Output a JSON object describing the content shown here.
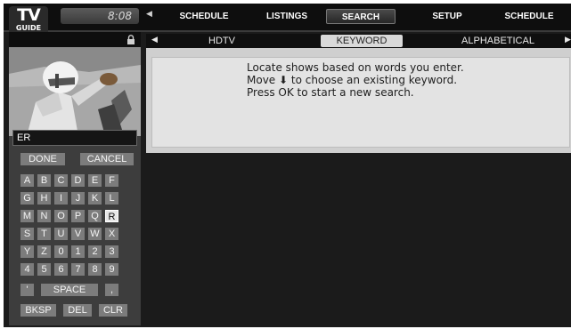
{
  "logo": {
    "line1": "TV",
    "line2": "GUIDE"
  },
  "clock": "8:08",
  "nav": {
    "tabs": [
      {
        "label": "SCHEDULE"
      },
      {
        "label": "LISTINGS"
      },
      {
        "label": "SEARCH"
      },
      {
        "label": "SETUP"
      },
      {
        "label": "SCHEDULE"
      }
    ]
  },
  "subtabs": [
    {
      "label": "HDTV"
    },
    {
      "label": "KEYWORD"
    },
    {
      "label": "ALPHABETICAL"
    }
  ],
  "entry": {
    "value": "ER"
  },
  "keyboard": {
    "done": "DONE",
    "cancel": "CANCEL",
    "rows": [
      [
        "A",
        "B",
        "C",
        "D",
        "E",
        "F"
      ],
      [
        "G",
        "H",
        "I",
        "J",
        "K",
        "L"
      ],
      [
        "M",
        "N",
        "O",
        "P",
        "Q",
        "R"
      ],
      [
        "S",
        "T",
        "U",
        "V",
        "W",
        "X"
      ],
      [
        "Y",
        "Z",
        "0",
        "1",
        "2",
        "3"
      ],
      [
        "4",
        "5",
        "6",
        "7",
        "8",
        "9"
      ]
    ],
    "apostrophe": "'",
    "space": "SPACE",
    "comma": ",",
    "bksp": "BKSP",
    "del": "DEL",
    "clr": "CLR"
  },
  "info": {
    "line1": "Locate shows based on words you enter.",
    "line2": "Move ⬇ to choose an existing keyword.",
    "line3": "Press OK to start a new search."
  }
}
